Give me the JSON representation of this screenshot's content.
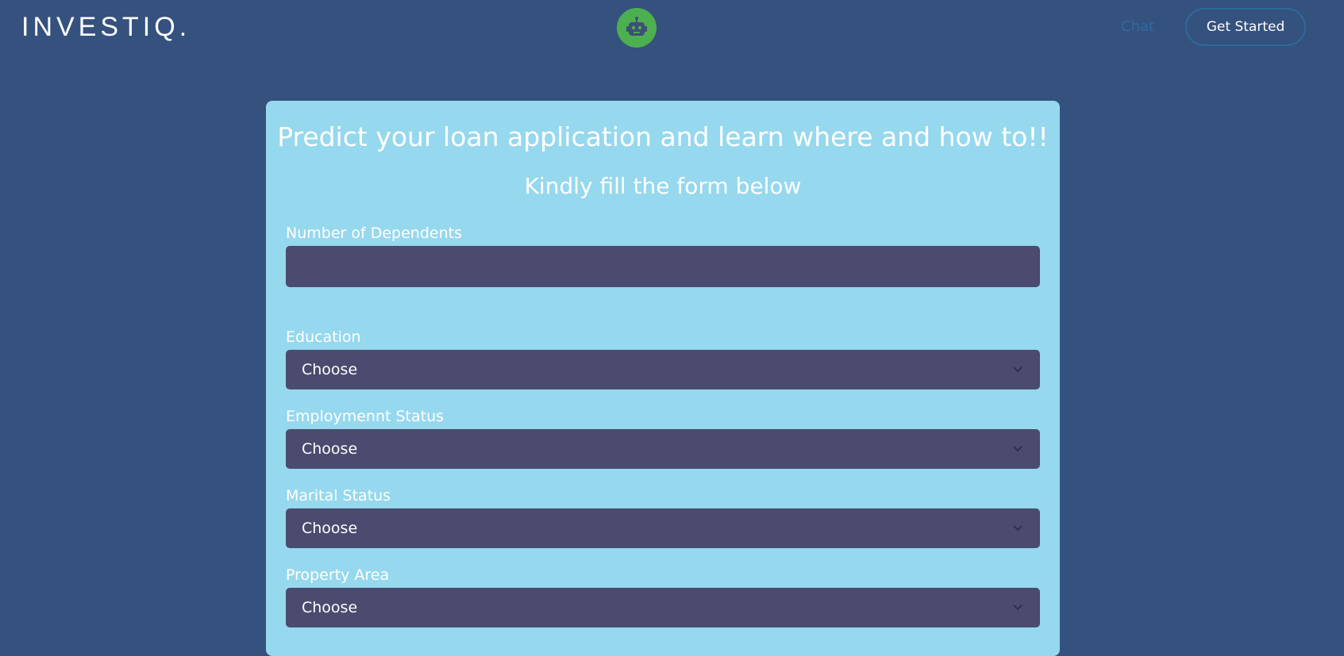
{
  "header": {
    "brand": "INVESTIQ.",
    "chat_link": "Chat",
    "cta_label": "Get Started"
  },
  "form": {
    "title": "Predict your loan application and learn where and how to!!",
    "subtitle": "Kindly fill the form below",
    "dependents": {
      "label": "Number of Dependents",
      "value": ""
    },
    "education": {
      "label": "Education",
      "value": "Choose"
    },
    "employment": {
      "label": "Employmennt Status",
      "value": "Choose"
    },
    "marital": {
      "label": "Marital Status",
      "value": "Choose"
    },
    "property": {
      "label": "Property Area",
      "value": "Choose"
    }
  },
  "colors": {
    "page_background": "#35517e",
    "card_background": "#96d8ee",
    "field_background": "#4a4b6e",
    "bot_badge": "#4caf50",
    "link_color": "#2e6aa0"
  },
  "icons": {
    "bot": "robot-icon",
    "select_arrow": "chevron-down-icon"
  }
}
